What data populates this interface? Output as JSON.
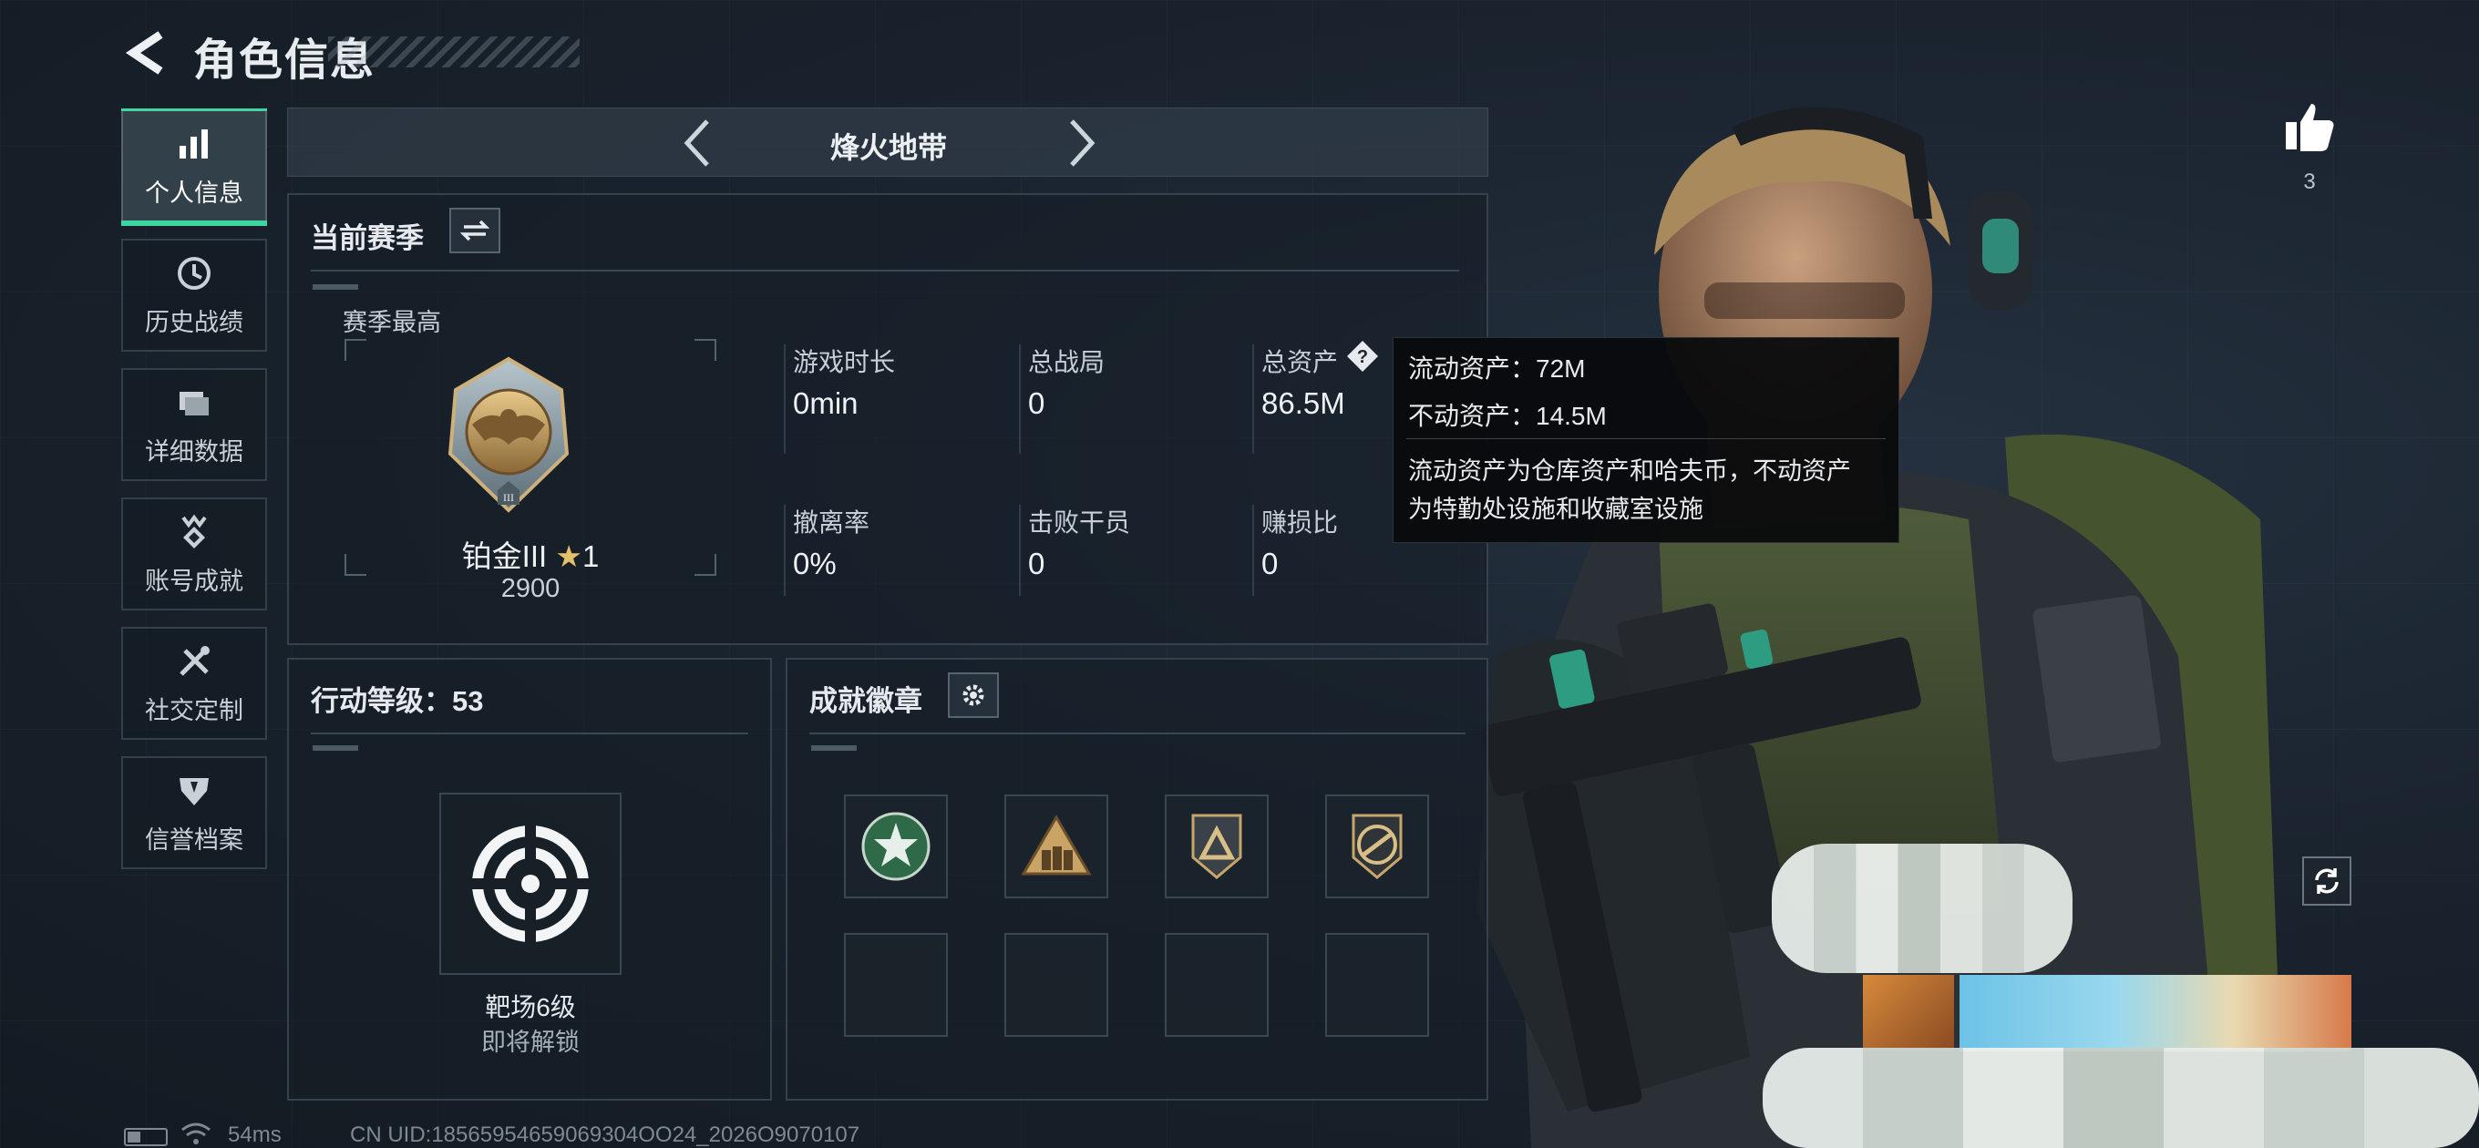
{
  "header": {
    "title": "角色信息"
  },
  "nav": [
    {
      "label": "个人信息",
      "icon": "bar-chart-icon",
      "active": true
    },
    {
      "label": "历史战绩",
      "icon": "history-clock-icon",
      "active": false
    },
    {
      "label": "详细数据",
      "icon": "folder-icon",
      "active": false
    },
    {
      "label": "账号成就",
      "icon": "medal-icon",
      "active": false
    },
    {
      "label": "社交定制",
      "icon": "tools-icon",
      "active": false
    },
    {
      "label": "信誉档案",
      "icon": "shield-icon",
      "active": false
    }
  ],
  "mode": {
    "title": "烽火地带"
  },
  "season": {
    "section_title": "当前赛季",
    "best_label": "赛季最高",
    "rank_name": "铂金III",
    "rank_stars": "1",
    "rank_points": "2900",
    "rank_roman": "III",
    "stats": [
      {
        "label": "游戏时长",
        "value": "0min"
      },
      {
        "label": "总战局",
        "value": "0"
      },
      {
        "label": "总资产",
        "value": "86.5M"
      },
      {
        "label": "撤离率",
        "value": "0%"
      },
      {
        "label": "击败干员",
        "value": "0"
      },
      {
        "label": "赚损比",
        "value": "0"
      }
    ]
  },
  "tooltip": {
    "line1": "流动资产：72M",
    "line2": "不动资产：14.5M",
    "desc1": "流动资产为仓库资产和哈夫币，不动资产",
    "desc2": "为特勤处设施和收藏室设施"
  },
  "level": {
    "section_title": "行动等级：53",
    "unlock_name": "靶场6级",
    "unlock_status": "即将解锁"
  },
  "badges": {
    "section_title": "成就徽章",
    "items": [
      "badge-star-icon",
      "badge-soldiers-icon",
      "badge-triangle-icon",
      "badge-rifle-icon"
    ]
  },
  "likes": {
    "count": "3"
  },
  "status": {
    "ping": "54ms",
    "uid": "CN UID:18565954659069304OO24_2026O9070107"
  },
  "colors": {
    "accent": "#3ed6a1",
    "panel_border": "#35424d",
    "background": "#1a232e"
  }
}
